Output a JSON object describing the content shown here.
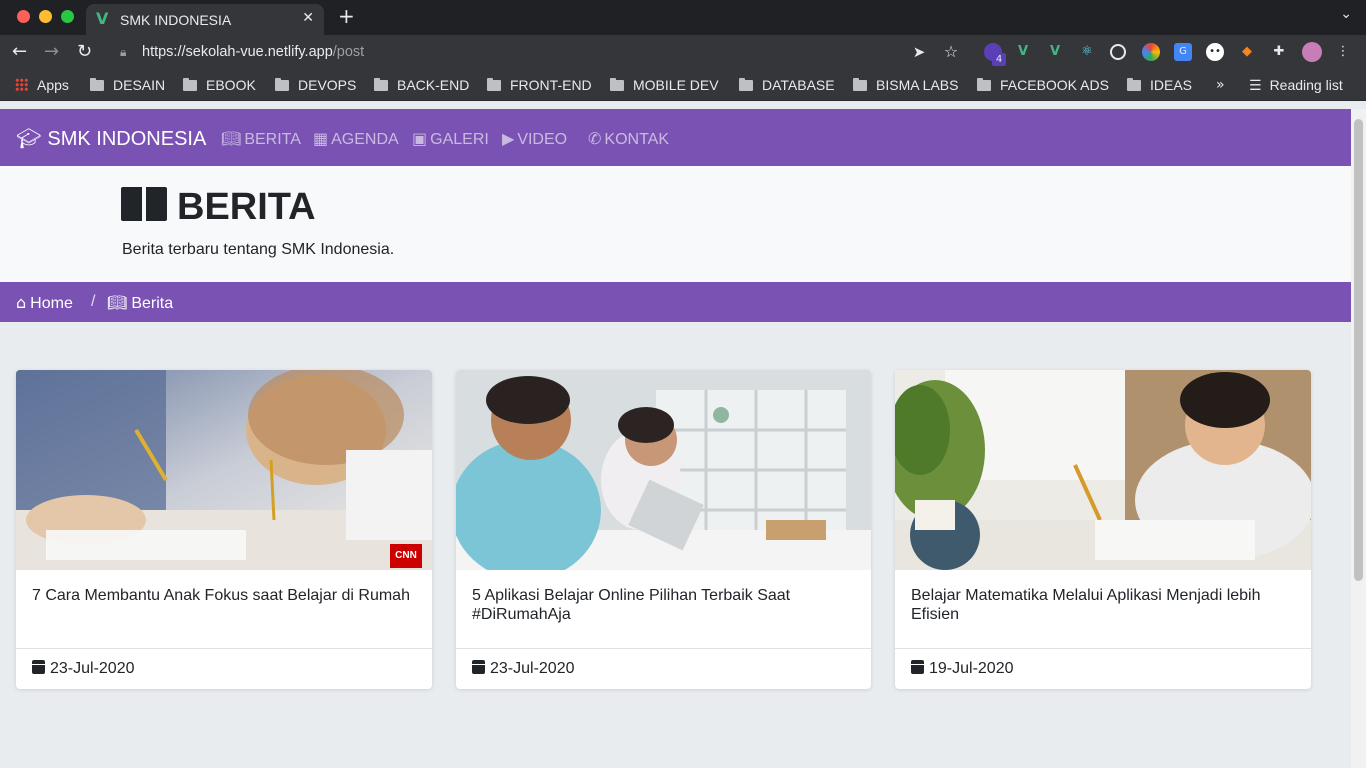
{
  "browser": {
    "tab_title": "SMK INDONESIA",
    "url_host": "https://sekolah-vue.netlify.app",
    "url_path": "/post",
    "extension_badge": "4",
    "bookmarks": [
      "Apps",
      "DESAIN",
      "EBOOK",
      "DEVOPS",
      "BACK-END",
      "FRONT-END",
      "MOBILE DEV",
      "DATABASE",
      "BISMA LABS",
      "FACEBOOK ADS",
      "IDEAS"
    ],
    "overflow": "»",
    "reading_list": "Reading list"
  },
  "nav": {
    "brand": "SMK INDONESIA",
    "items": [
      "BERITA",
      "AGENDA",
      "GALERI",
      "VIDEO",
      "KONTAK"
    ]
  },
  "header": {
    "title": "BERITA",
    "subtitle": "Berita terbaru tentang SMK Indonesia."
  },
  "breadcrumb": {
    "home": "Home",
    "separator": "/",
    "current": "Berita"
  },
  "posts": [
    {
      "title": "7 Cara Membantu Anak Fokus saat Belajar di Rumah",
      "date": "23-Jul-2020",
      "image_badge": "CNN"
    },
    {
      "title": "5 Aplikasi Belajar Online Pilihan Terbaik Saat #DiRumahAja",
      "date": "23-Jul-2020"
    },
    {
      "title": "Belajar Matematika Melalui Aplikasi Menjadi lebih Efisien",
      "date": "19-Jul-2020"
    }
  ],
  "colors": {
    "primary": "#7952b3",
    "light": "#f8f9fa",
    "background": "#e9ecef"
  }
}
